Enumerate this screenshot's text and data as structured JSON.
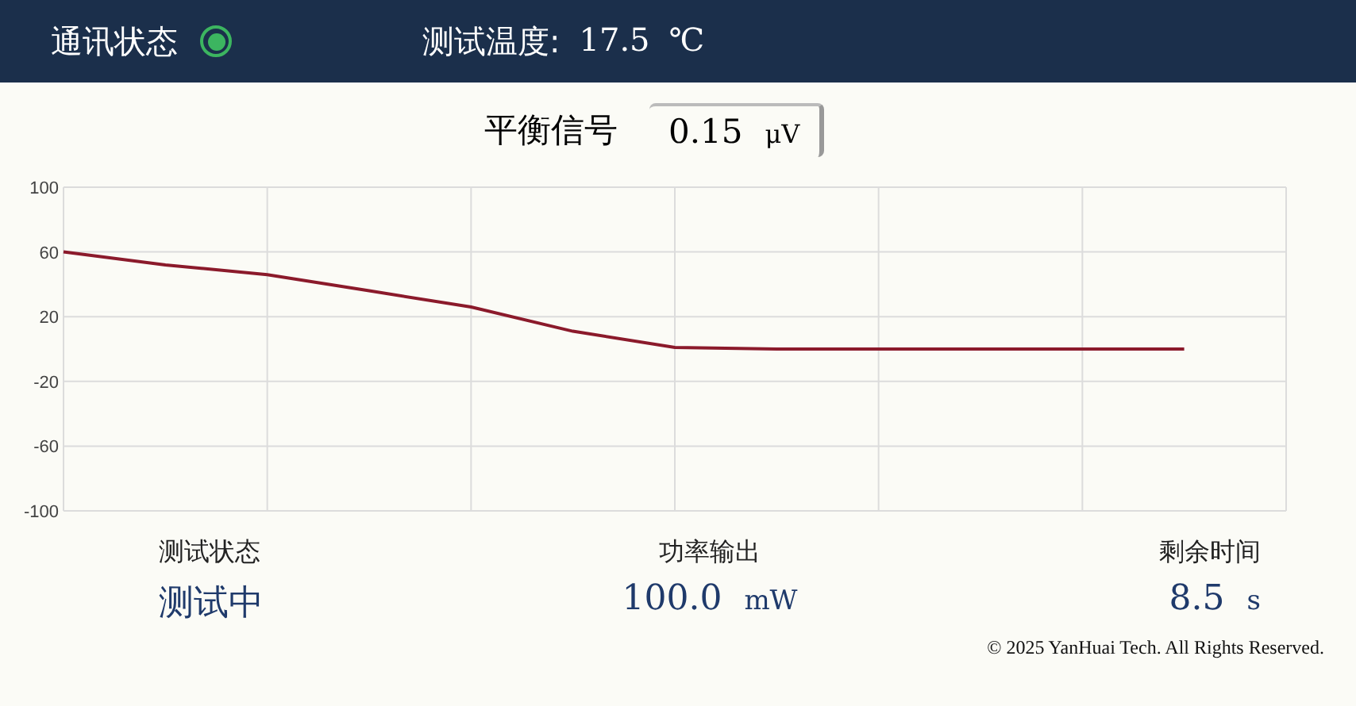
{
  "header": {
    "comm_label": "通讯状态",
    "comm_ok": true,
    "temp_label": "测试温度:",
    "temp_value": "17.5",
    "temp_unit": "℃"
  },
  "balance": {
    "label": "平衡信号",
    "value": "0.15",
    "unit": "μV"
  },
  "chart_data": {
    "type": "line",
    "grid": true,
    "ylim": [
      -100,
      100
    ],
    "yticks": [
      100,
      60,
      20,
      -20,
      -60,
      -100
    ],
    "categories": [
      null,
      null,
      null,
      null,
      null,
      null,
      null,
      null,
      null,
      null,
      null,
      null
    ],
    "series": [
      {
        "color": "#8b1a2b",
        "values": [
          60,
          52,
          46,
          36,
          26,
          11,
          1,
          0,
          0,
          0,
          0,
          0
        ]
      }
    ]
  },
  "readouts": [
    {
      "label": "测试状态",
      "value": "测试中"
    },
    {
      "label": "功率输出",
      "value": "100.0",
      "unit": "mW"
    },
    {
      "label": "剩余时间",
      "value": "8.5",
      "unit": "s"
    }
  ],
  "footer": "© 2025 YanHuai Tech. All Rights Reserved."
}
